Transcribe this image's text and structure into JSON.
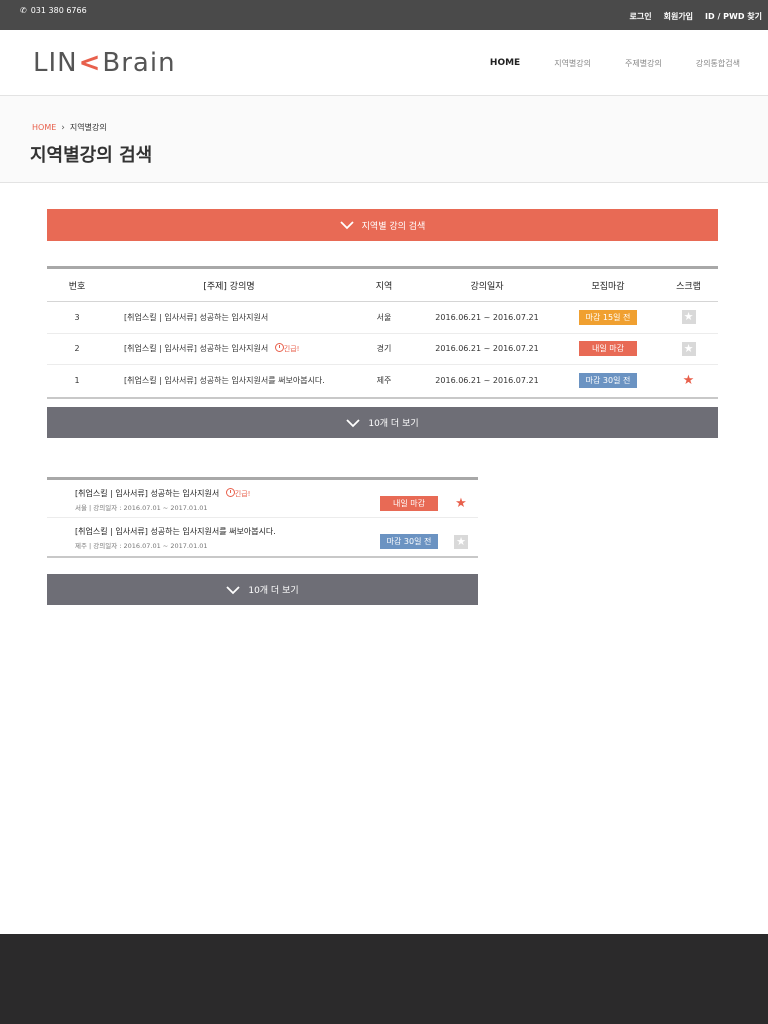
{
  "topbar": {
    "phone": "031 380 6766",
    "links": [
      "로그인",
      "회원가입",
      "ID / PWD 찾기"
    ]
  },
  "header": {
    "logo_left": "LIN",
    "logo_k": "<",
    "logo_right": "Brain",
    "nav": [
      "HOME",
      "지역별강의",
      "주제별강의",
      "강의통합검색"
    ]
  },
  "breadcrumb": {
    "home": "HOME",
    "current": "지역별강의"
  },
  "page_title": "지역별강의 검색",
  "search_bar": {
    "label": "지역별 강의 검색"
  },
  "table": {
    "headers": {
      "no": "번호",
      "title": "[주제]  강의명",
      "area": "지역",
      "date": "강의일자",
      "deadline": "모집마감",
      "scrap": "스크랩"
    },
    "rows": [
      {
        "no": "3",
        "title": "[취업스킬 | 입사서류]  성공하는 입사지원서",
        "urgent": "",
        "area": "서울",
        "date": "2016.06.21 ~ 2016.07.21",
        "deadline": "마감 15일 전",
        "deadline_color": "#f0a030",
        "scrapped": false
      },
      {
        "no": "2",
        "title": "[취업스킬 | 입사서류]  성공하는 입사지원서",
        "urgent": "긴급!",
        "area": "경기",
        "date": "2016.06.21 ~ 2016.07.21",
        "deadline": "내일 마감",
        "deadline_color": "#e86a55",
        "scrapped": false
      },
      {
        "no": "1",
        "title": "[취업스킬 | 입사서류]  성공하는 입사지원서를 써보아봅시다.",
        "urgent": "",
        "area": "제주",
        "date": "2016.06.21 ~ 2016.07.21",
        "deadline": "마감 30일 전",
        "deadline_color": "#6b93c2",
        "scrapped": true
      }
    ]
  },
  "more_button": {
    "label": "10개 더 보기"
  },
  "mobile_list": {
    "items": [
      {
        "title": "[취업스킬 | 입사서류]   성공하는 입사지원서",
        "urgent": "긴급!",
        "sub": "서울  |  강의일자 : 2016.07.01 ~ 2017.01.01",
        "deadline": "내일 마감",
        "scrapped": true
      },
      {
        "title": "[취업스킬 | 입사서류]   성공하는 입사지원서를 써보아봅시다.",
        "urgent": "",
        "sub": "제주  |  강의일자 : 2016.07.01 ~ 2017.01.01",
        "deadline": "마감 30일 전",
        "scrapped": false
      }
    ]
  },
  "more_button_2": {
    "label": "10개 더 보기"
  }
}
